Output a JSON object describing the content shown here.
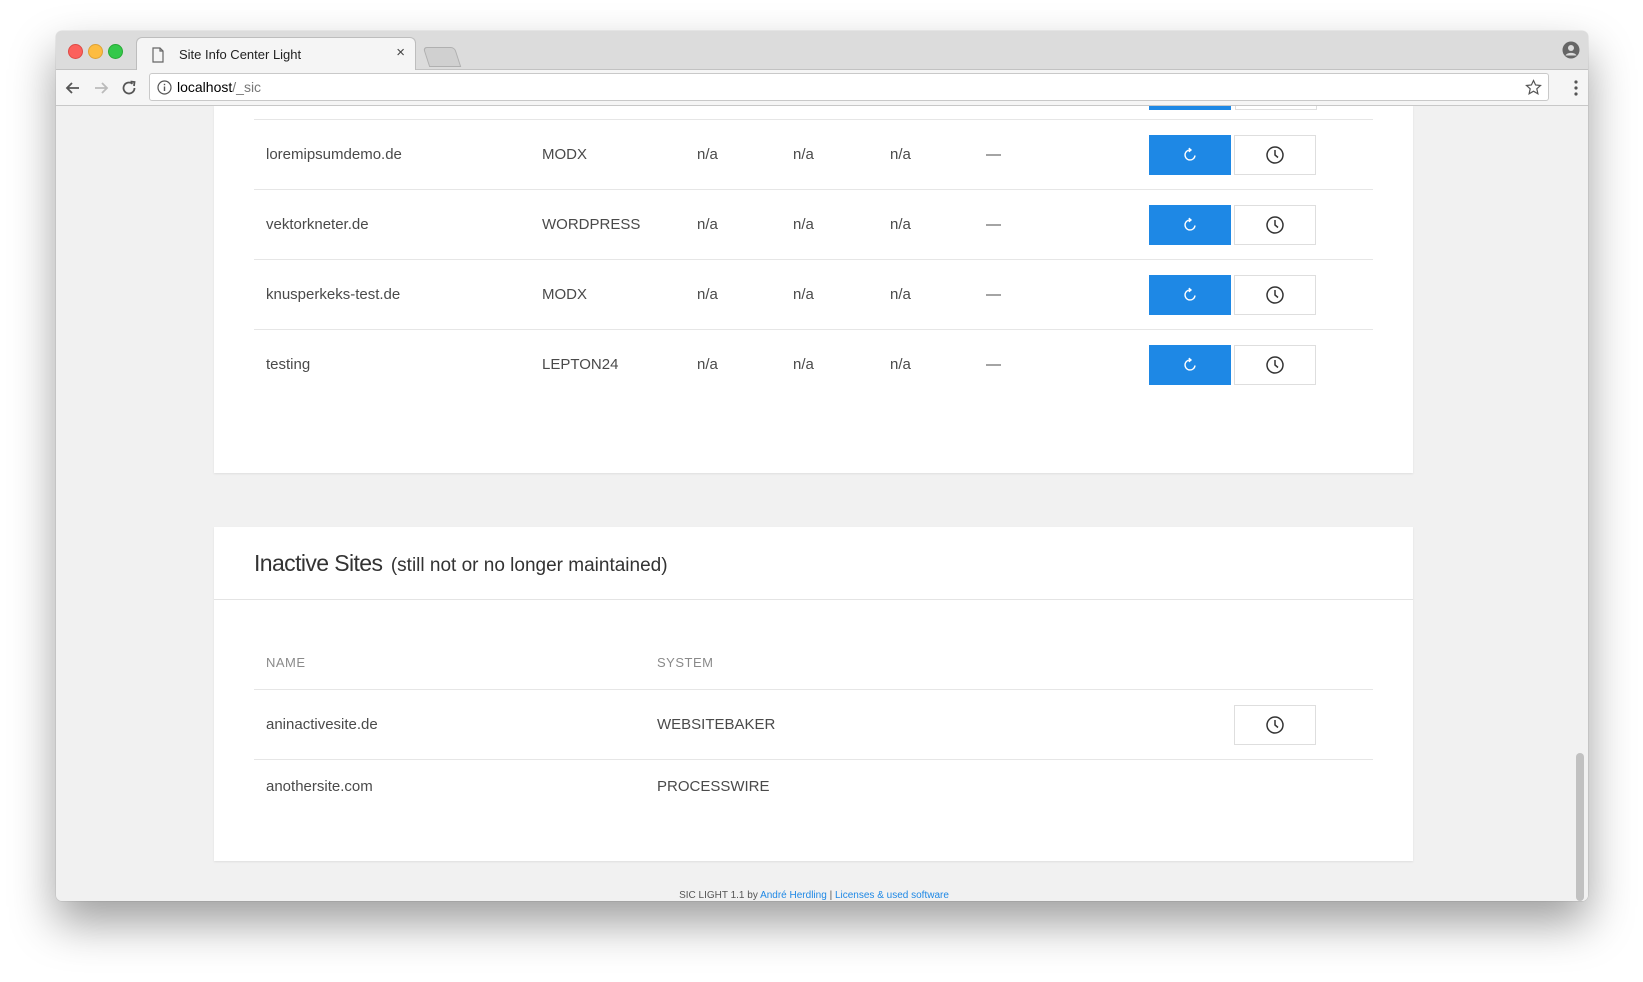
{
  "browser": {
    "tab_title": "Site Info Center Light",
    "tab_close": "×",
    "url_host": "localhost",
    "url_path": "/_sic"
  },
  "active_sites": [
    {
      "name": "loremipsumdemo.de",
      "system": "MODX",
      "col3": "n/a",
      "col4": "n/a",
      "col5": "n/a",
      "col6": "—"
    },
    {
      "name": "vektorkneter.de",
      "system": "WORDPRESS",
      "col3": "n/a",
      "col4": "n/a",
      "col5": "n/a",
      "col6": "—"
    },
    {
      "name": "knusperkeks-test.de",
      "system": "MODX",
      "col3": "n/a",
      "col4": "n/a",
      "col5": "n/a",
      "col6": "—"
    },
    {
      "name": "testing",
      "system": "LEPTON24",
      "col3": "n/a",
      "col4": "n/a",
      "col5": "n/a",
      "col6": "—"
    }
  ],
  "inactive": {
    "title": "Inactive Sites",
    "subtitle": "(still not or no longer maintained)",
    "headers": {
      "name": "NAME",
      "system": "SYSTEM"
    },
    "rows": [
      {
        "name": "aninactivesite.de",
        "system": "WEBSITEBAKER"
      },
      {
        "name": "anothersite.com",
        "system": "PROCESSWIRE"
      }
    ]
  },
  "footer": {
    "prefix": "SIC LIGHT 1.1 by",
    "author": "André Herdling",
    "separator": "|",
    "licenses": "Licenses & used software"
  },
  "icons": {
    "refresh": "refresh-icon",
    "history": "clock-icon"
  },
  "colors": {
    "accent": "#1e88e5",
    "background": "#f1f1f1"
  }
}
